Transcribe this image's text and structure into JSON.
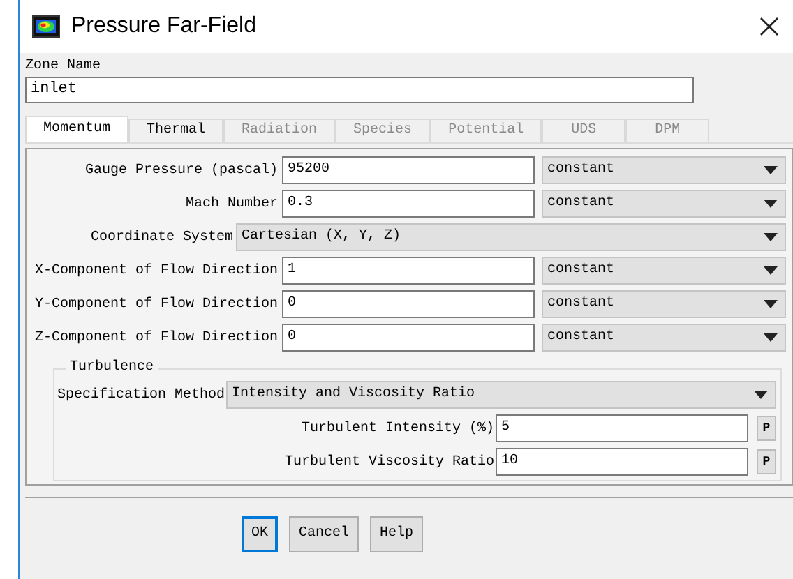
{
  "window": {
    "title": "Pressure Far-Field"
  },
  "zone_name": {
    "label": "Zone Name",
    "value": "inlet"
  },
  "tabs": [
    {
      "label": "Momentum",
      "selected": true,
      "disabled": false
    },
    {
      "label": "Thermal",
      "selected": false,
      "disabled": false
    },
    {
      "label": "Radiation",
      "selected": false,
      "disabled": true
    },
    {
      "label": "Species",
      "selected": false,
      "disabled": true
    },
    {
      "label": "Potential",
      "selected": false,
      "disabled": true
    },
    {
      "label": "UDS",
      "selected": false,
      "disabled": true
    },
    {
      "label": "DPM",
      "selected": false,
      "disabled": true
    }
  ],
  "fields": [
    {
      "kind": "value",
      "label": "Gauge Pressure (pascal)",
      "value": "95200",
      "profile": "constant"
    },
    {
      "kind": "value",
      "label": "Mach Number",
      "value": "0.3",
      "profile": "constant"
    },
    {
      "kind": "choice",
      "label": "Coordinate System",
      "value": "Cartesian (X, Y, Z)"
    },
    {
      "kind": "value",
      "label": "X-Component of Flow Direction",
      "value": "1",
      "profile": "constant"
    },
    {
      "kind": "value",
      "label": "Y-Component of Flow Direction",
      "value": "0",
      "profile": "constant"
    },
    {
      "kind": "value",
      "label": "Z-Component of Flow Direction",
      "value": "0",
      "profile": "constant"
    }
  ],
  "turbulence": {
    "title": "Turbulence",
    "specification": {
      "label": "Specification Method",
      "value": "Intensity and Viscosity Ratio"
    },
    "fields": [
      {
        "label": "Turbulent Intensity (%)",
        "value": "5",
        "button": "P"
      },
      {
        "label": "Turbulent Viscosity Ratio",
        "value": "10",
        "button": "P"
      }
    ]
  },
  "buttons": [
    {
      "label": "OK",
      "selected": true
    },
    {
      "label": "Cancel",
      "selected": false
    },
    {
      "label": "Help",
      "selected": false
    }
  ]
}
